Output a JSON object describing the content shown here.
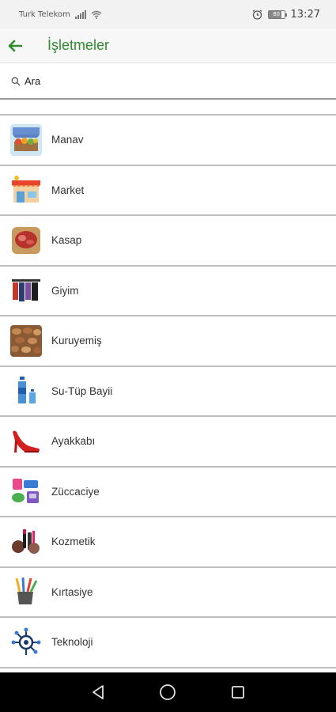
{
  "status_bar": {
    "carrier": "Turk Telekom",
    "battery": "80",
    "time": "13:27"
  },
  "app_bar": {
    "title": "İşletmeler"
  },
  "search": {
    "placeholder": "Ara"
  },
  "categories": [
    {
      "label": "Manav",
      "icon": "greengrocer-icon"
    },
    {
      "label": "Market",
      "icon": "market-icon"
    },
    {
      "label": "Kasap",
      "icon": "butcher-icon"
    },
    {
      "label": "Giyim",
      "icon": "clothing-icon"
    },
    {
      "label": "Kuruyemiş",
      "icon": "nuts-icon"
    },
    {
      "label": "Su-Tüp Bayii",
      "icon": "water-bottle-icon"
    },
    {
      "label": "Ayakkabı",
      "icon": "shoe-icon"
    },
    {
      "label": "Züccaciye",
      "icon": "housewares-icon"
    },
    {
      "label": "Kozmetik",
      "icon": "cosmetics-icon"
    },
    {
      "label": "Kırtasiye",
      "icon": "stationery-icon"
    },
    {
      "label": "Teknoloji",
      "icon": "technology-icon"
    }
  ],
  "colors": {
    "accent": "#2e8b2e",
    "divider": "#bdbdbd",
    "nav_bar": "#000000"
  }
}
